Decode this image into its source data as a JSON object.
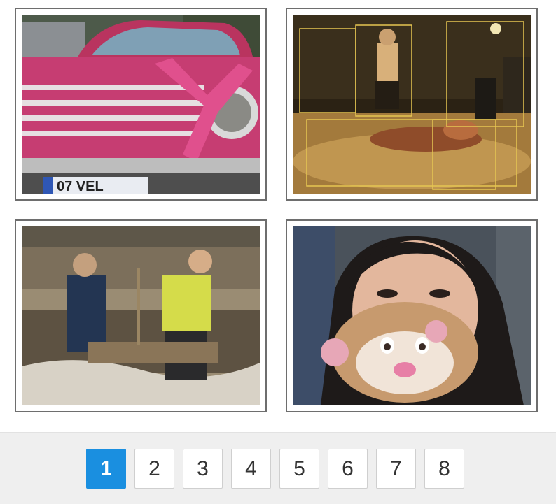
{
  "gallery": {
    "images": [
      {
        "name": "pink-car-photo"
      },
      {
        "name": "night-street-photo"
      },
      {
        "name": "digging-men-photo"
      },
      {
        "name": "masked-woman-photo"
      }
    ]
  },
  "pagination": {
    "current": "1",
    "pages": [
      "1",
      "2",
      "3",
      "4",
      "5",
      "6",
      "7",
      "8"
    ]
  },
  "colors": {
    "accent": "#1a8fe0",
    "frame": "#6e6e6e",
    "bar": "#efefef"
  }
}
